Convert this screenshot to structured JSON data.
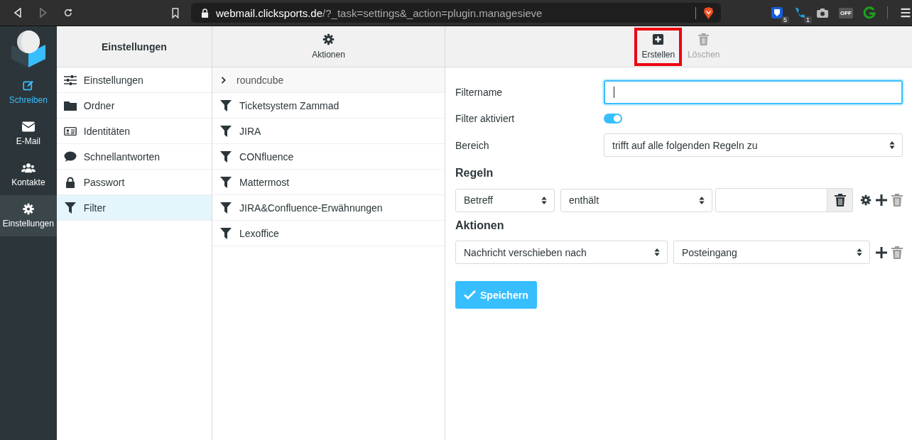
{
  "browser": {
    "back_enabled": true,
    "forward_enabled": false,
    "url_host": "webmail.clicksports.de",
    "url_path": "/?_task=settings&_action=plugin.managesieve",
    "extensions": [
      {
        "kind": "shield",
        "badge": "5"
      },
      {
        "kind": "phone",
        "badge": "1"
      },
      {
        "kind": "camera"
      },
      {
        "kind": "off",
        "label": "OFF"
      },
      {
        "kind": "g"
      }
    ]
  },
  "rail": [
    {
      "kind": "compose",
      "label": "Schreiben",
      "selected": false
    },
    {
      "kind": "mail",
      "label": "E-Mail",
      "selected": false
    },
    {
      "kind": "contacts",
      "label": "Kontakte",
      "selected": false
    },
    {
      "kind": "settings",
      "label": "Einstellungen",
      "selected": true
    }
  ],
  "settings": {
    "title": "Einstellungen",
    "items": [
      {
        "kind": "sliders",
        "label": "Einstellungen",
        "selected": false
      },
      {
        "kind": "folder",
        "label": "Ordner",
        "selected": false
      },
      {
        "kind": "idcard",
        "label": "Identitäten",
        "selected": false
      },
      {
        "kind": "comment",
        "label": "Schnellantworten",
        "selected": false
      },
      {
        "kind": "lock",
        "label": "Passwort",
        "selected": false
      },
      {
        "kind": "filter",
        "label": "Filter",
        "selected": true
      }
    ]
  },
  "filters": {
    "actions_label": "Aktionen",
    "set_name": "roundcube",
    "items": [
      "Ticketsystem Zammad",
      "JIRA",
      "CONfluence",
      "Mattermost",
      "JIRA&Confluence-Erwähnungen",
      "Lexoffice"
    ]
  },
  "toolbar": [
    {
      "kind": "create",
      "label": "Erstellen",
      "disabled": false,
      "highlighted": true
    },
    {
      "kind": "delete",
      "label": "Löschen",
      "disabled": true,
      "highlighted": false
    }
  ],
  "form": {
    "name_label": "Filtername",
    "active_label": "Filter aktiviert",
    "active": true,
    "scope_label": "Bereich",
    "scope": "trifft auf alle folgenden Regeln zu",
    "rules_heading": "Regeln",
    "rule": {
      "header": "Betreff",
      "operator": "enthält"
    },
    "actions_heading": "Aktionen",
    "action": {
      "type": "Nachricht verschieben nach",
      "folder": "Posteingang"
    },
    "save": "Speichern"
  }
}
